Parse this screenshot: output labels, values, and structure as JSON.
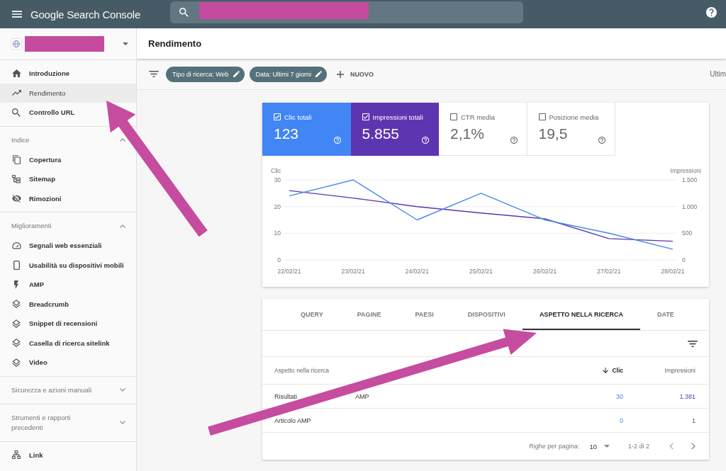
{
  "header": {
    "title": "Google Search Console"
  },
  "sidebar": {
    "groups": [
      {
        "items": [
          {
            "label": "Introduzione",
            "selected": false
          },
          {
            "label": "Rendimento",
            "selected": true
          },
          {
            "label": "Controllo URL",
            "selected": false
          }
        ]
      },
      {
        "title": "Indice",
        "expanded": true,
        "items": [
          {
            "label": "Copertura",
            "selected": false
          },
          {
            "label": "Sitemap",
            "selected": false
          },
          {
            "label": "Rimozioni",
            "selected": false
          }
        ]
      },
      {
        "title": "Miglioramenti",
        "expanded": true,
        "items": [
          {
            "label": "Segnali web essenziali",
            "selected": false
          },
          {
            "label": "Usabilità su dispositivi mobili",
            "selected": false
          },
          {
            "label": "AMP",
            "selected": false
          },
          {
            "label": "Breadcrumb",
            "selected": false
          },
          {
            "label": "Snippet di recensioni",
            "selected": false
          },
          {
            "label": "Casella di ricerca sitelink",
            "selected": false
          },
          {
            "label": "Video",
            "selected": false
          }
        ]
      },
      {
        "title": "Sicurezza e azioni manuali",
        "expanded": false
      },
      {
        "title": "Strumenti e rapporti precedenti",
        "expanded": false
      },
      {
        "items": [
          {
            "label": "Link",
            "selected": false
          }
        ]
      }
    ]
  },
  "page_title": "Rendimento",
  "filters": {
    "chips": [
      "Tipo di ricerca: Web",
      "Data: Ultimi 7 giorni"
    ],
    "add_label": "NUOVO",
    "date_range": "Ultim"
  },
  "metrics": [
    {
      "label": "Clic totali",
      "value": "123",
      "checked": true,
      "color": "#4285f4"
    },
    {
      "label": "Impressioni totali",
      "value": "5.855",
      "checked": true,
      "color": "#5e35b1"
    },
    {
      "label": "CTR media",
      "value": "2,1%",
      "checked": false
    },
    {
      "label": "Posizione media",
      "value": "19,5",
      "checked": false
    }
  ],
  "chart_data": {
    "type": "line",
    "ylabel": "Clic",
    "y2label": "Impressioni",
    "categories": [
      "22/02/21",
      "23/02/21",
      "24/02/21",
      "25/02/21",
      "26/02/21",
      "27/02/21",
      "28/02/21"
    ],
    "ylim": [
      0,
      30
    ],
    "yticks": [
      0,
      10,
      20,
      30
    ],
    "y2lim": [
      0,
      1500
    ],
    "y2ticks": [
      {
        "value": 0,
        "label": "0"
      },
      {
        "value": 500,
        "label": "500"
      },
      {
        "value": 1000,
        "label": "1.000"
      },
      {
        "value": 1500,
        "label": "1.500"
      }
    ],
    "series": [
      {
        "color": "#4a89e8",
        "values": [
          24,
          30,
          15,
          25,
          15,
          10,
          4
        ]
      },
      {
        "axis": "y2",
        "color": "#5e35b1",
        "values": [
          1300,
          1160,
          1000,
          880,
          770,
          400,
          350
        ]
      }
    ]
  },
  "report": {
    "tabs": [
      {
        "label": "QUERY",
        "selected": false
      },
      {
        "label": "PAGINE",
        "selected": false
      },
      {
        "label": "PAESI",
        "selected": false
      },
      {
        "label": "DISPOSITIVI",
        "selected": false
      },
      {
        "label": "ASPETTO NELLA RICERCA",
        "selected": true
      },
      {
        "label": "DATE",
        "selected": false
      }
    ],
    "columns": [
      {
        "label": "Aspetto nella ricerca",
        "sorted": false
      },
      {
        "label": "Clic",
        "sorted": true
      },
      {
        "label": "Impressioni",
        "sorted": false
      }
    ],
    "rows": [
      {
        "label_parts": [
          "Risultati",
          "AMP"
        ],
        "values": [
          "30",
          "1.381"
        ]
      },
      {
        "label_parts": [
          "Articolo AMP"
        ],
        "values": [
          "0",
          "1"
        ]
      }
    ],
    "pagination": {
      "rows_label": "Righe per pagina:",
      "rows_value": "10",
      "range": "1-2 di 2"
    }
  }
}
